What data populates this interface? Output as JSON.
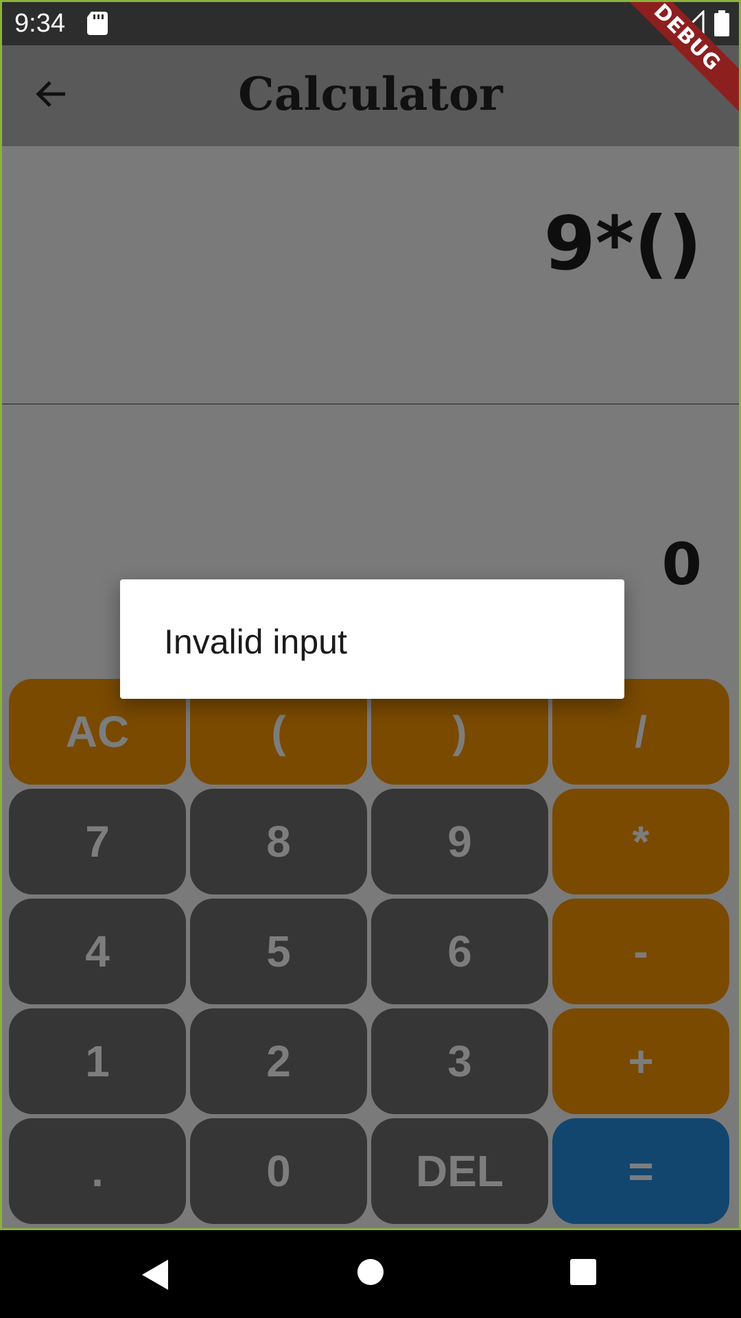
{
  "status_bar": {
    "time": "9:34",
    "debug_label": "DEBUG"
  },
  "app_bar": {
    "title": "Calculator"
  },
  "display": {
    "expression": "9*()",
    "result": "0"
  },
  "dialog": {
    "message": "Invalid input"
  },
  "keypad": {
    "keys": [
      {
        "label": "AC",
        "type": "orange"
      },
      {
        "label": "(",
        "type": "orange"
      },
      {
        "label": ")",
        "type": "orange"
      },
      {
        "label": "/",
        "type": "orange"
      },
      {
        "label": "7",
        "type": "dark"
      },
      {
        "label": "8",
        "type": "dark"
      },
      {
        "label": "9",
        "type": "dark"
      },
      {
        "label": "*",
        "type": "orange"
      },
      {
        "label": "4",
        "type": "dark"
      },
      {
        "label": "5",
        "type": "dark"
      },
      {
        "label": "6",
        "type": "dark"
      },
      {
        "label": "-",
        "type": "orange"
      },
      {
        "label": "1",
        "type": "dark"
      },
      {
        "label": "2",
        "type": "dark"
      },
      {
        "label": "3",
        "type": "dark"
      },
      {
        "label": "+",
        "type": "orange"
      },
      {
        "label": ".",
        "type": "dark"
      },
      {
        "label": "0",
        "type": "dark"
      },
      {
        "label": "DEL",
        "type": "dark"
      },
      {
        "label": "=",
        "type": "blue"
      }
    ]
  },
  "colors": {
    "operator_key": "#7a4a00",
    "digit_key": "#363636",
    "equals_key": "#12466f",
    "display_bg": "#7a7a7a",
    "app_bar_bg": "#595959"
  }
}
